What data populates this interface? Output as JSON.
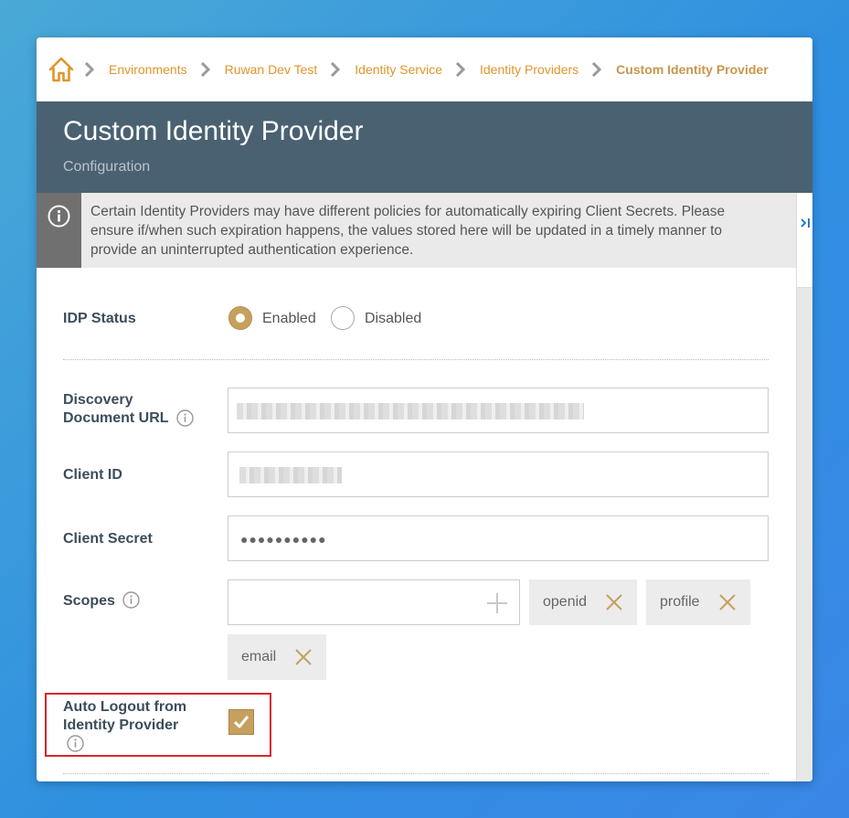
{
  "breadcrumb": {
    "items": [
      "Environments",
      "Ruwan Dev Test",
      "Identity Service",
      "Identity Providers",
      "Custom Identity Provider"
    ]
  },
  "header": {
    "title": "Custom Identity Provider",
    "subtitle": "Configuration"
  },
  "notice": {
    "text": "Certain Identity Providers may have different policies for automatically expiring Client Secrets. Please ensure if/when such expiration happens, the values stored here will be updated in a timely manner to provide an uninterrupted authentication experience."
  },
  "form": {
    "idp_status": {
      "label": "IDP Status",
      "options": [
        "Enabled",
        "Disabled"
      ],
      "selected": "Enabled"
    },
    "discovery_url": {
      "label_line1": "Discovery",
      "label_line2": "Document URL"
    },
    "client_id": {
      "label": "Client ID"
    },
    "client_secret": {
      "label": "Client Secret",
      "masked": "●●●●●●●●●●"
    },
    "scopes": {
      "label": "Scopes",
      "values": [
        "openid",
        "profile",
        "email"
      ]
    },
    "auto_logout": {
      "label_line1": "Auto Logout from",
      "label_line2": "Identity Provider",
      "checked": true
    }
  },
  "colors": {
    "accent": "#c6a05f",
    "link": "#e0952a",
    "header_bg": "#4a6172",
    "highlight": "#d9262b"
  },
  "icons": [
    "home-icon",
    "chevron-right-icon",
    "info-icon",
    "collapse-panel-icon",
    "plus-icon",
    "close-icon",
    "check-icon"
  ]
}
